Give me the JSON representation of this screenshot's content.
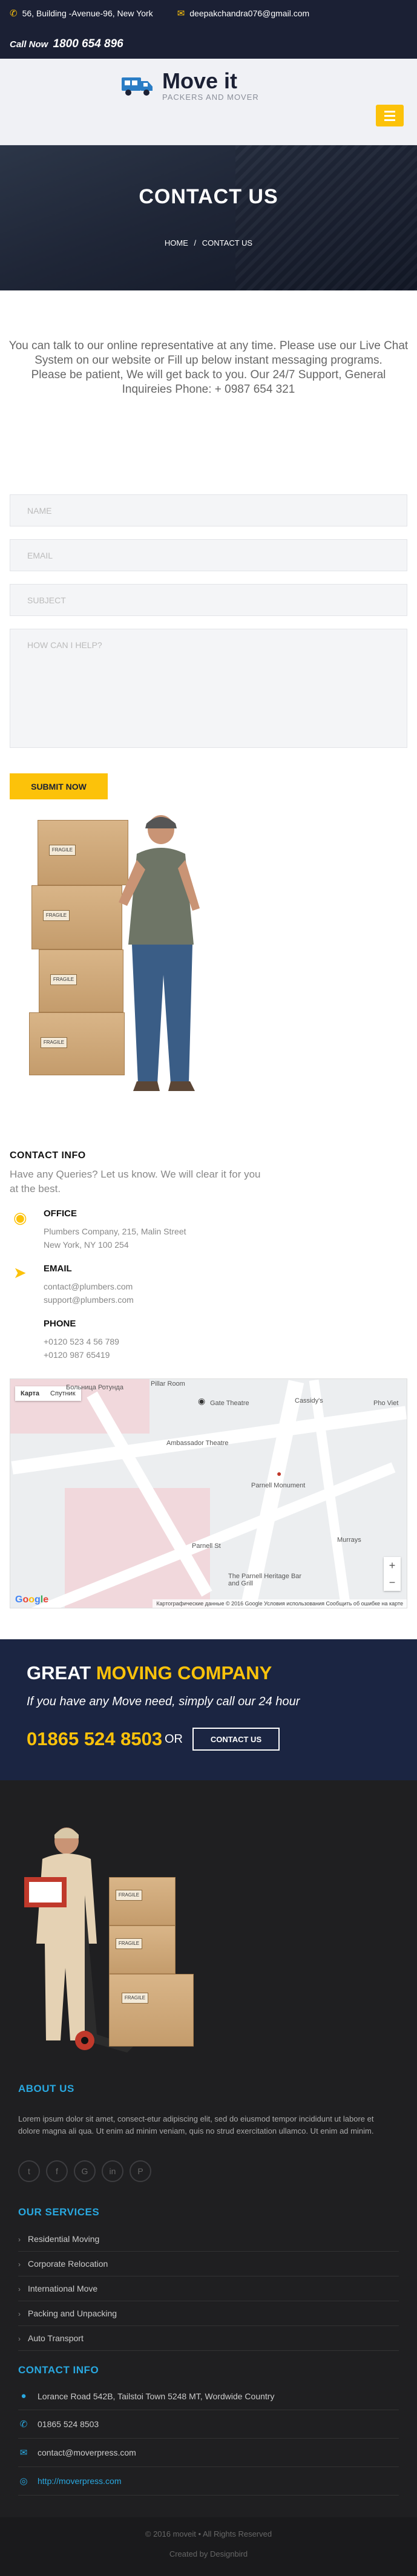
{
  "topbar": {
    "address": "56, Building -Avenue-96, New York",
    "email": "deepakchandra076@gmail.com",
    "call_label": "Call Now",
    "call_number": "1800 654 896"
  },
  "logo": {
    "name": "Move it",
    "tagline": "PACKERS AND MOVER"
  },
  "hero": {
    "title": "CONTACT US",
    "breadcrumb_home": "HOME",
    "breadcrumb_sep": "/",
    "breadcrumb_current": "CONTACT US"
  },
  "intro": {
    "line1": "You can talk to our online representative at any time. Please use our Live Chat System on our website or Fill up below instant messaging programs.",
    "line2": "Please be patient, We will get back to you. Our 24/7 Support, General Inquireies Phone: + 0987 654 321"
  },
  "form": {
    "name_placeholder": "NAME",
    "email_placeholder": "EMAIL",
    "subject_placeholder": "SUBJECT",
    "message_placeholder": "HOW CAN I HELP?",
    "submit_label": "SUBMIT NOW"
  },
  "boxes": {
    "label": "FRAGILE"
  },
  "contact_info": {
    "title": "CONTACT INFO",
    "lead": "Have any Queries? Let us know. We will clear it for you at the best.",
    "office_title": "OFFICE",
    "office_line1": "Plumbers Company, 215, Malin Street",
    "office_line2": "New York, NY 100 254",
    "email_title": "EMAIL",
    "email_line1": "contact@plumbers.com",
    "email_line2": "support@plumbers.com",
    "phone_title": "PHONE",
    "phone_line1": "+0120 523 4 56 789",
    "phone_line2": "+0120 987 65419"
  },
  "map": {
    "type_map": "Карта",
    "type_satellite": "Спутник",
    "labels": [
      "Gate Theatre",
      "Cassidy's",
      "Pho Viet",
      "Ambassador Theatre",
      "Parnell Monument",
      "The Parnell Heritage Bar and Grill",
      "Murrays",
      "Pillar Room",
      "Parnell St",
      "Больница Ротунда"
    ],
    "attribution": "Картографические данные © 2016 Google   Условия использования   Сообщить об ошибке на карте",
    "zoom_in": "+",
    "zoom_out": "−"
  },
  "banner": {
    "title_white": "GREAT",
    "title_yellow": "MOVING COMPANY",
    "subtitle": "If you have any Move need, simply call our 24 hour",
    "phone": "01865 524 8503",
    "or": "OR",
    "button": "CONTACT US"
  },
  "footer": {
    "about_title": "ABOUT US",
    "about_text": "Lorem ipsum dolor sit amet, consect-etur adipiscing elit, sed do eiusmod tempor incididunt ut labore et dolore magna ali qua. Ut enim ad minim veniam, quis no strud exercitation ullamco. Ut enim ad minim.",
    "services_title": "OUR SERVICES",
    "services": [
      "Residential Moving",
      "Corporate Relocation",
      "International Move",
      "Packing and Unpacking",
      "Auto Transport"
    ],
    "info_title": "CONTACT INFO",
    "info_address": "Lorance Road 542B, Tailstoi Town    5248 MT, Wordwide Country",
    "info_phone": "01865 524 8503",
    "info_email": "contact@moverpress.com",
    "info_web": "http://moverpress.com",
    "copyright": "© 2016 moveit • All Rights Reserved",
    "credit": "Created by Designbird"
  },
  "colors": {
    "accent": "#fcc20a",
    "dark_navy": "#1b2034",
    "link_blue": "#29a8e0"
  }
}
